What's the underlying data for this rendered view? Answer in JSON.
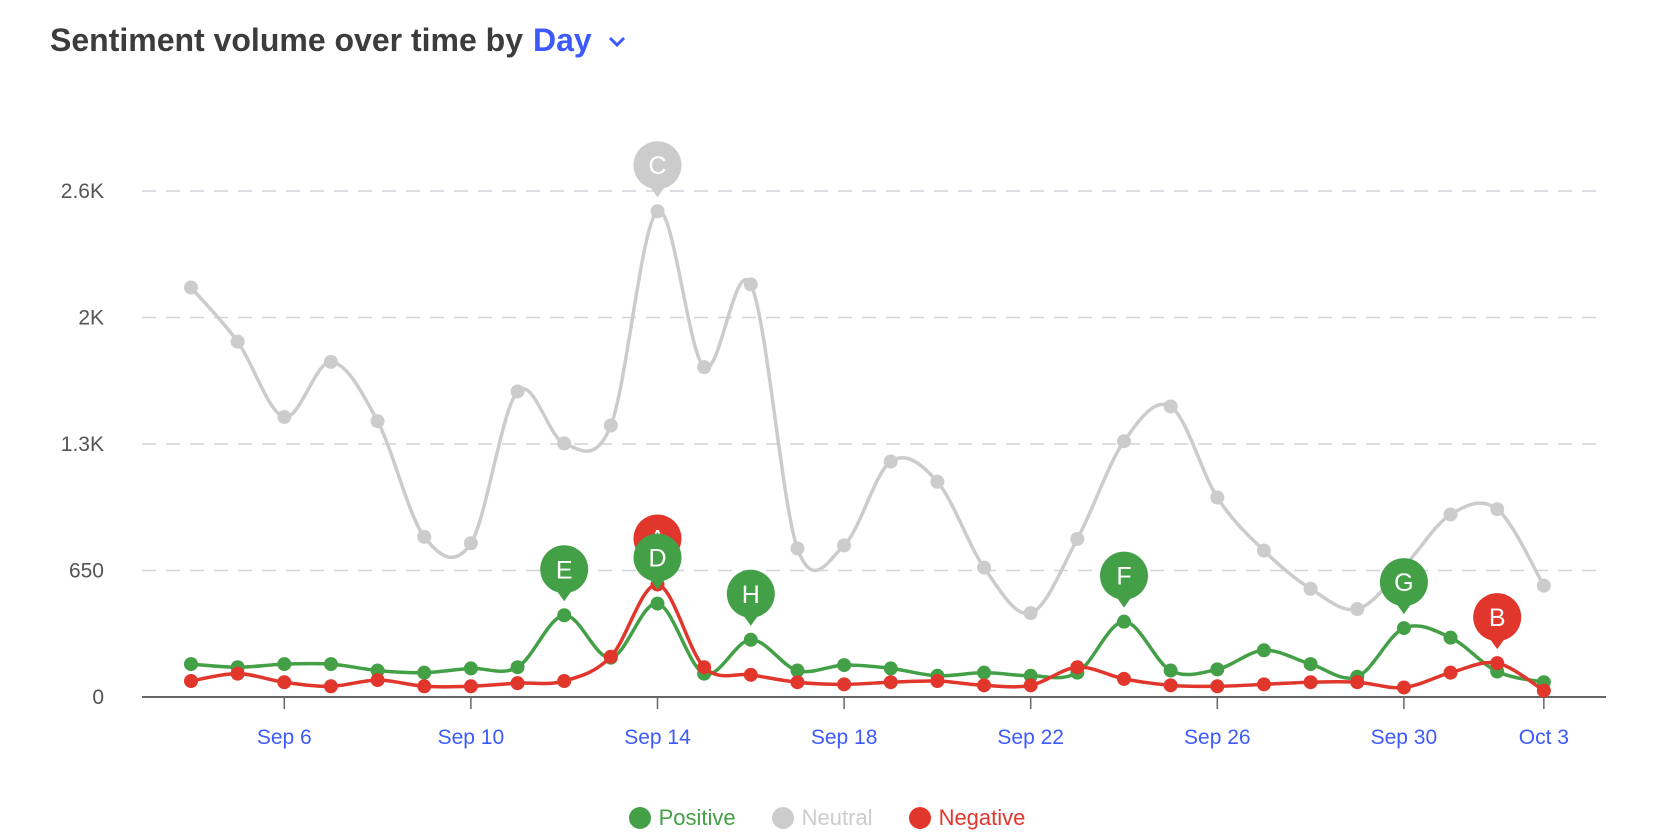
{
  "title": {
    "prefix": "Sentiment volume over time by",
    "granularity": "Day"
  },
  "chart_data": {
    "type": "line",
    "title": "Sentiment volume over time by Day",
    "x": [
      "Sep 4",
      "Sep 5",
      "Sep 6",
      "Sep 7",
      "Sep 8",
      "Sep 9",
      "Sep 10",
      "Sep 11",
      "Sep 12",
      "Sep 13",
      "Sep 14",
      "Sep 15",
      "Sep 16",
      "Sep 17",
      "Sep 18",
      "Sep 19",
      "Sep 20",
      "Sep 21",
      "Sep 22",
      "Sep 23",
      "Sep 24",
      "Sep 25",
      "Sep 26",
      "Sep 27",
      "Sep 28",
      "Sep 29",
      "Sep 30",
      "Oct 1",
      "Oct 2",
      "Oct 3"
    ],
    "x_ticks": [
      "Sep 6",
      "Sep 10",
      "Sep 14",
      "Sep 18",
      "Sep 22",
      "Sep 26",
      "Sep 30",
      "Oct 3"
    ],
    "y_ticks": [
      {
        "value": 0,
        "label": "0"
      },
      {
        "value": 650,
        "label": "650"
      },
      {
        "value": 1300,
        "label": "1.3K"
      },
      {
        "value": 1950,
        "label": "2K"
      },
      {
        "value": 2600,
        "label": "2.6K"
      }
    ],
    "ylim": [
      0,
      2600
    ],
    "grid": true,
    "legend_position": "bottom",
    "series": [
      {
        "name": "Positive",
        "color": "#43a047",
        "values": [
          169,
          153,
          169,
          169,
          136,
          125,
          147,
          153,
          420,
          202,
          480,
          120,
          294,
          136,
          164,
          147,
          109,
          125,
          109,
          125,
          387,
          136,
          142,
          240,
          169,
          104,
          354,
          305,
          131,
          76
        ]
      },
      {
        "name": "Neutral",
        "color": "#cccccc",
        "values": [
          2104,
          1826,
          1439,
          1722,
          1417,
          823,
          790,
          1570,
          1303,
          1395,
          2496,
          1695,
          2120,
          763,
          779,
          1210,
          1106,
          665,
          431,
          812,
          1314,
          1493,
          1025,
          752,
          556,
          452,
          670,
          938,
          965,
          572
        ]
      },
      {
        "name": "Negative",
        "color": "#e0362c",
        "values": [
          82,
          120,
          76,
          55,
          87,
          55,
          55,
          71,
          82,
          207,
          578,
          153,
          114,
          76,
          65,
          76,
          82,
          60,
          60,
          153,
          93,
          60,
          55,
          65,
          76,
          76,
          49,
          125,
          174,
          33
        ]
      }
    ],
    "annotations": [
      {
        "label": "C",
        "series": "Neutral",
        "x": "Sep 14"
      },
      {
        "label": "A",
        "series": "Negative",
        "x": "Sep 14"
      },
      {
        "label": "D",
        "series": "Positive",
        "x": "Sep 14"
      },
      {
        "label": "E",
        "series": "Positive",
        "x": "Sep 12"
      },
      {
        "label": "H",
        "series": "Positive",
        "x": "Sep 16"
      },
      {
        "label": "F",
        "series": "Positive",
        "x": "Sep 24"
      },
      {
        "label": "G",
        "series": "Positive",
        "x": "Sep 30"
      },
      {
        "label": "B",
        "series": "Negative",
        "x": "Oct 2"
      }
    ]
  },
  "colors": {
    "accent": "#3d5afe",
    "axis_label": "#555555",
    "grid": "#d0d3dc"
  }
}
